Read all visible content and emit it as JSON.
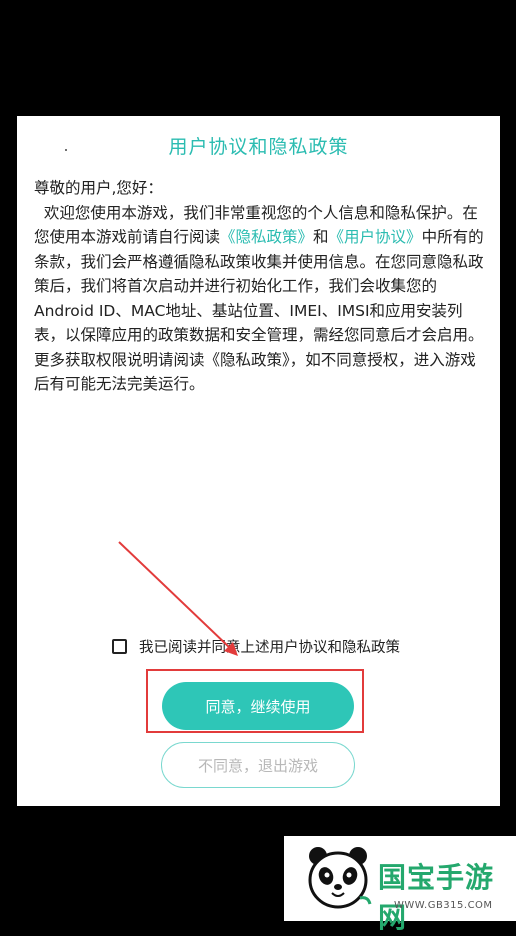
{
  "dialog": {
    "title": "用户协议和隐私政策",
    "greeting": "尊敬的用户,您好：",
    "paragraph": {
      "part1": "  欢迎您使用本游戏，我们非常重视您的个人信息和隐私保护。在您使用本游戏前请自行阅读",
      "link1": "《隐私政策》",
      "part2": "和",
      "link2": "《用户协议》",
      "part3": "中所有的条款，我们会严格遵循隐私政策收集并使用信息。在您同意隐私政策后，我们将首次启动并进行初始化工作，我们会收集您的Android ID、MAC地址、基站位置、IMEI、IMSI和应用安装列表，以保障应用的政策数据和安全管理，需经您同意后才会启用。更多获取权限说明请阅读《隐私政策》，如不同意授权，进入游戏后有可能无法完美运行。"
    },
    "agree_checkbox_label": "我已阅读并同意上述用户协议和隐私政策",
    "agree_checked": false,
    "agree_button": "同意，继续使用",
    "disagree_button": "不同意，退出游戏"
  },
  "watermark": {
    "brand": "国宝手游网",
    "url": "WWW.GB315.COM"
  },
  "colors": {
    "accent": "#2ec6b7",
    "annotation": "#e23b3b",
    "watermark_green": "#24a86d"
  }
}
